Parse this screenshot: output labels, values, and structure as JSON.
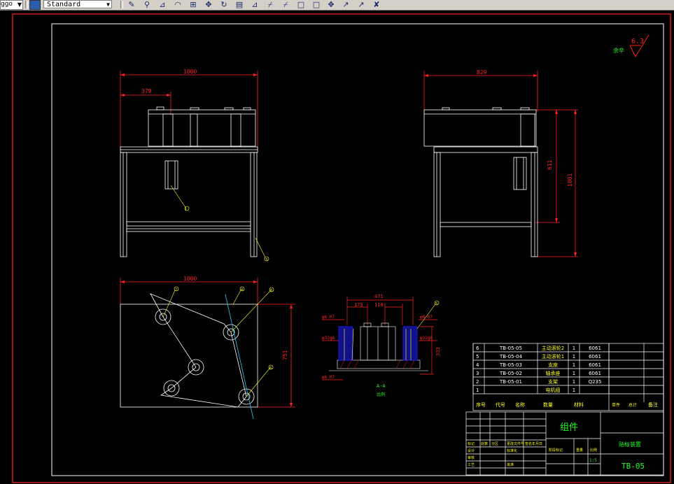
{
  "toolbar": {
    "layer_combo_value": "ggo",
    "text_style_value": "Standard",
    "buttons": [
      {
        "name": "linear-dimension-button",
        "glyph": "✎"
      },
      {
        "name": "aligned-dimension-button",
        "glyph": "⚲"
      },
      {
        "name": "ordinate-dimension-button",
        "glyph": "⊿"
      },
      {
        "name": "radius-dimension-button",
        "glyph": "◠"
      },
      {
        "name": "baseline-dimension-button",
        "glyph": "⊞"
      },
      {
        "name": "continue-dimension-button",
        "glyph": "✥"
      },
      {
        "name": "angular-dimension-button",
        "glyph": "↻"
      },
      {
        "name": "quick-dimension-button",
        "glyph": "▤"
      },
      {
        "name": "tolerance-button",
        "glyph": "⊿"
      },
      {
        "name": "center-mark-button",
        "glyph": "⌿"
      },
      {
        "name": "dimension-edit-button",
        "glyph": "⌿"
      },
      {
        "name": "dimension-text-edit-button",
        "glyph": "□"
      },
      {
        "name": "dimension-update-button",
        "glyph": "□"
      },
      {
        "name": "dimension-style-button",
        "glyph": "✥"
      },
      {
        "name": "oblique-button",
        "glyph": "↗"
      },
      {
        "name": "override-button",
        "glyph": "↗"
      },
      {
        "name": "dimension-manager-button",
        "glyph": "✘"
      }
    ]
  },
  "drawing": {
    "roughness_value": "6.3",
    "roughness_note": "余辛",
    "front_view": {
      "width_dim": "1000",
      "offset_dim": "379",
      "balloon_1": "1",
      "balloon_3": "3"
    },
    "side_view": {
      "width_dim": "829",
      "height_dim_inner": "611",
      "height_dim_outer": "1001"
    },
    "top_view": {
      "width_dim": "1000",
      "height_dim": "751",
      "balloons": [
        "2",
        "4",
        "6",
        "6"
      ]
    },
    "section_view": {
      "dim_total": "471",
      "dim_left": "173",
      "dim_mid": "118",
      "note_tl": "φ6 H7",
      "note_tr": "φ6 H7",
      "note_bl": "φ6 H7",
      "fit_left": "φ32g6",
      "fit_right": "φ32g6",
      "dim_right": "333",
      "balloon": "5",
      "section_label": "A-A",
      "section_note": "比例"
    }
  },
  "bom": {
    "rows": [
      {
        "no": "6",
        "code": "TB-05-05",
        "name": "主动滚轮2",
        "qty": "1",
        "material": "6061"
      },
      {
        "no": "5",
        "code": "TB-05-04",
        "name": "主动滚轮1",
        "qty": "1",
        "material": "6061"
      },
      {
        "no": "4",
        "code": "TB-05-03",
        "name": "支座",
        "qty": "1",
        "material": "6061"
      },
      {
        "no": "3",
        "code": "TB-05-02",
        "name": "轴承座",
        "qty": "1",
        "material": "6061"
      },
      {
        "no": "2",
        "code": "TB-05-01",
        "name": "支架",
        "qty": "1",
        "material": "Q235"
      },
      {
        "no": "1",
        "code": "",
        "name": "电机组",
        "qty": "1",
        "material": ""
      }
    ],
    "headers": [
      "序号",
      "代号",
      "名称",
      "数量",
      "材料",
      "单件",
      "总计",
      "备注"
    ]
  },
  "title_block": {
    "part_name": "组件",
    "assembly_name": "贴标装置",
    "drawing_number": "TB-05",
    "scale": "1:5",
    "labels": [
      "标记",
      "处数",
      "分区",
      "更改文件号",
      "签名",
      "年月日",
      "设计",
      "标准化",
      "审核",
      "工艺",
      "批准",
      "阶段标记",
      "重量",
      "比例"
    ]
  },
  "colors": {
    "background": "#000000",
    "frame": "#ffffff",
    "dimension": "#ff2020",
    "green": "#20ff20",
    "yellow": "#ffff20",
    "blue": "#2020ff",
    "cyan": "#20d0ff",
    "toolbar": "#d4d0c8"
  }
}
